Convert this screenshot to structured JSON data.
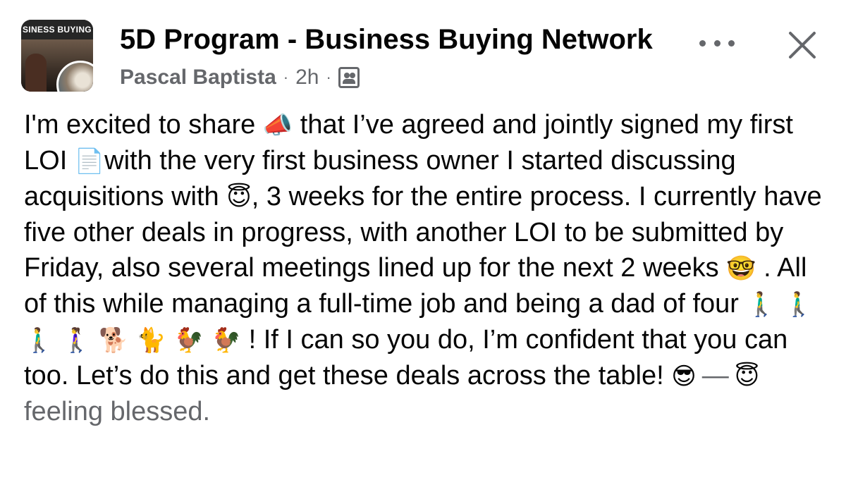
{
  "header": {
    "group_title": "5D Program - Business Buying Network",
    "avatar_text": "SINESS BUYING NET",
    "author": "Pascal Baptista",
    "separator": "·",
    "time": "2h",
    "audience_icon": "group-audience-icon",
    "more_icon": "more-options-icon",
    "close_icon": "close-icon"
  },
  "post": {
    "s1": "I'm excited to share ",
    "e1": "📣",
    "s2": " that I’ve agreed and jointly signed my first LOI ",
    "e2": "📄",
    "s3": "with the very first business owner I started discussing acquisitions with ",
    "e3": "😇",
    "s4": ", 3 weeks for the entire process. I currently have five other deals in progress, with another LOI to be submitted by Friday, also several meetings lined up for the next 2 weeks ",
    "e4": "🤓",
    "s5": " . All of this while managing a full-time job and being a dad of four ",
    "e5": "🚶‍♂️ 🚶‍♂️ 🚶‍♂️ 🚶‍♀️ 🐕 🐈 🐓 🐓",
    "s6": " ! If I can so you do, I’m confident that you can too. Let’s do this and get these deals across the table! ",
    "e6": "😎",
    "dash": "—",
    "feeling_emoji": "😇",
    "feeling": "feeling blessed."
  }
}
